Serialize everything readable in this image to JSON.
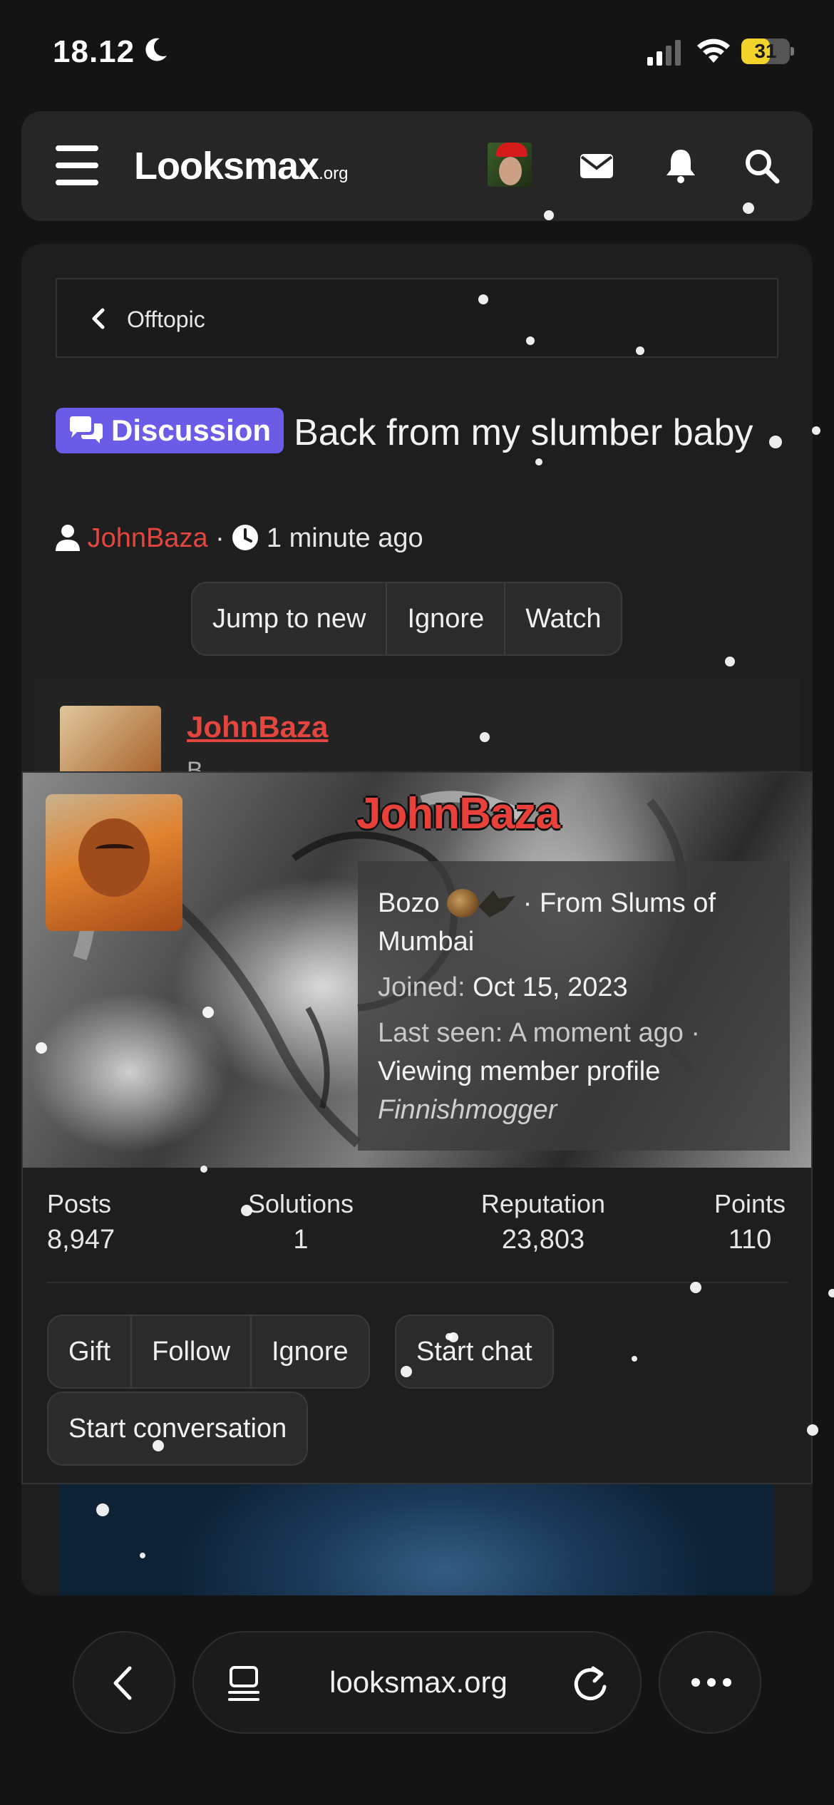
{
  "status_bar": {
    "time": "18.12",
    "battery_level": "31",
    "icons": [
      "moon-icon",
      "signal-icon",
      "wifi-icon",
      "battery-icon"
    ]
  },
  "header": {
    "logo_main": "Looksmax",
    "logo_suffix": ".org",
    "icons": [
      "menu-icon",
      "avatar",
      "mail-icon",
      "bell-icon",
      "search-icon"
    ]
  },
  "breadcrumb": {
    "label": "Offtopic"
  },
  "thread": {
    "tag": "Discussion",
    "title": "Back from my slumber baby",
    "author": "JohnBaza",
    "time_ago": "1 minute ago",
    "actions": [
      "Jump to new",
      "Ignore",
      "Watch"
    ]
  },
  "post": {
    "author": "JohnBaza",
    "sub": "B"
  },
  "profile": {
    "name": "JohnBaza",
    "title": "Bozo",
    "location": "· From Slums of Mumbai",
    "joined_label": "Joined:",
    "joined_value": "Oct 15, 2023",
    "last_seen_label": "Last seen:",
    "last_seen_value": "A moment ago ·",
    "activity": "Viewing member profile",
    "custom_title": "Finnishmogger",
    "stats": [
      {
        "label": "Posts",
        "value": "8,947"
      },
      {
        "label": "Solutions",
        "value": "1"
      },
      {
        "label": "Reputation",
        "value": "23,803"
      },
      {
        "label": "Points",
        "value": "110"
      }
    ],
    "actions_group": [
      "Gift",
      "Follow",
      "Ignore"
    ],
    "start_chat": "Start chat",
    "start_conversation": "Start conversation"
  },
  "browser": {
    "url": "looksmax.org"
  },
  "colors": {
    "accent_red": "#e2463f",
    "tag_purple": "#6b5ce7",
    "battery_yellow": "#f2d32c"
  }
}
